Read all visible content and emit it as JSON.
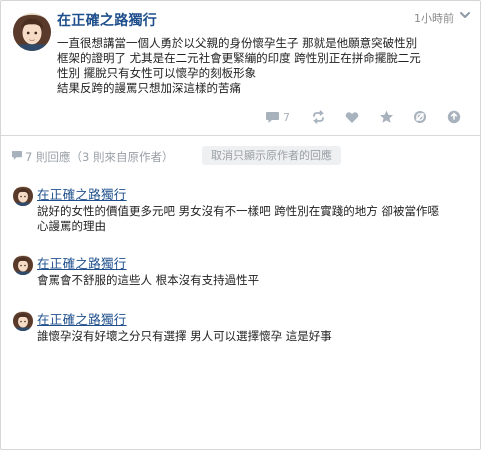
{
  "post": {
    "author": "在正確之路獨行",
    "time": "1小時前",
    "body": [
      "一直很想講當一個人勇於以父親的身份懷孕生子 那就是他願意突破性別",
      "框架的證明了 尤其是在二元社會更緊繃的印度 跨性別正在拼命擺脫二元",
      "性別 擺脫只有女性可以懷孕的刻板形象",
      "結果反跨的謾罵只想加深這樣的苦痛"
    ],
    "comment_count_badge": "7",
    "icons": [
      "comment-icon",
      "repost-icon",
      "heart-icon",
      "star-icon",
      "block-icon",
      "share-icon"
    ]
  },
  "comments_header": {
    "count_text": "7 則回應（3 則來自原作者）",
    "filter_label": "取消只顯示原作者的回應"
  },
  "comments": [
    {
      "author": "在正確之路獨行",
      "text": [
        "說好的女性的價值更多元吧 男女沒有不一樣吧 跨性別在實踐的地方 卻被當作噁",
        "心謾罵的理由"
      ]
    },
    {
      "author": "在正確之路獨行",
      "text": [
        "會罵會不舒服的這些人 根本沒有支持過性平"
      ]
    },
    {
      "author": "在正確之路獨行",
      "text": [
        "誰懷孕沒有好壞之分只有選擇 男人可以選擇懷孕 這是好事"
      ]
    }
  ],
  "colors": {
    "author_blue": "#1e4f8c",
    "icon_gray": "#a8b2bd",
    "muted_text": "#9aa0a6"
  }
}
